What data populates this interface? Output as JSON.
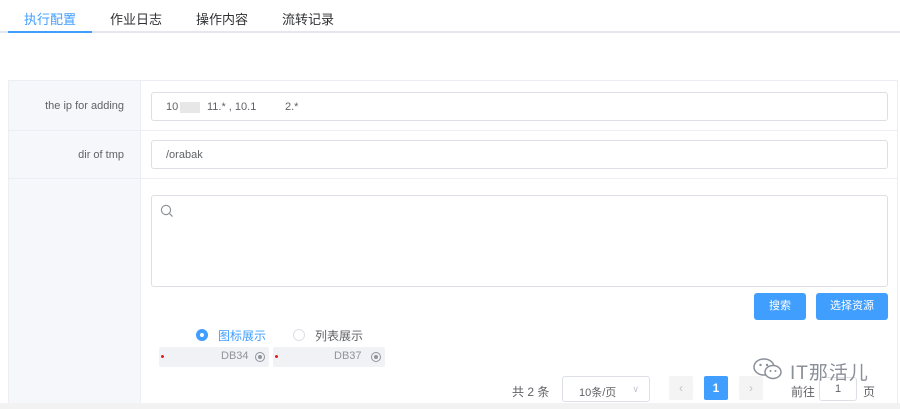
{
  "tabs": [
    {
      "label": "执行配置",
      "active": true
    },
    {
      "label": "作业日志",
      "active": false
    },
    {
      "label": "操作内容",
      "active": false
    },
    {
      "label": "流转记录",
      "active": false
    }
  ],
  "form": {
    "ip_row": {
      "label": "the ip for adding",
      "parts": [
        "10",
        "11.* , 10.1",
        "2.*"
      ]
    },
    "tmp_row": {
      "label": "dir of tmp",
      "value": "/orabak"
    },
    "resource_row": {
      "search_value": "",
      "search_button": "搜索",
      "select_button": "选择资源",
      "view_modes": [
        {
          "label": "图标展示",
          "checked": true
        },
        {
          "label": "列表展示",
          "checked": false
        }
      ],
      "resources": [
        {
          "name": "DB34"
        },
        {
          "name": "DB37"
        }
      ],
      "pagination": {
        "total": "共 2 条",
        "page_size": "10条/页",
        "prev": "‹",
        "current_page": "1",
        "next": "›",
        "goto_prefix": "前往",
        "goto_value": "1",
        "goto_suffix": "页"
      }
    }
  },
  "watermark": {
    "text": "IT那活儿"
  },
  "colors": {
    "accent": "#409eff",
    "label_bg": "#f5f7fa",
    "border": "#dcdfe6"
  },
  "icons": [
    "search-icon",
    "radio-icon",
    "chevron-down-icon",
    "chevron-left-icon",
    "chevron-right-icon",
    "wechat-icon"
  ]
}
